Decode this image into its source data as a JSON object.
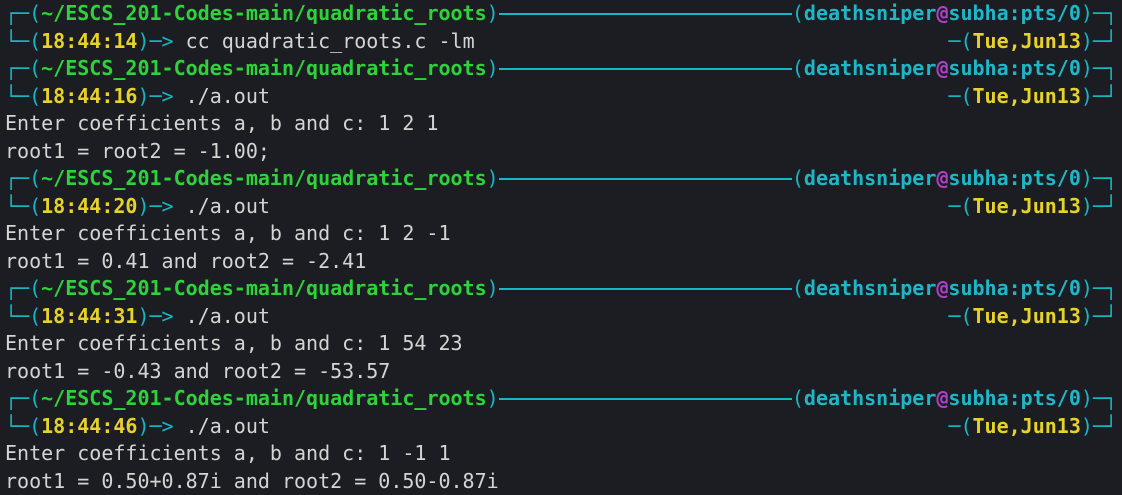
{
  "blocks": [
    {
      "path": "~/ESCS_201-Codes-main/quadratic_roots",
      "user": "deathsniper",
      "host": "subha:pts/0",
      "time": "18:44:14",
      "date": "Tue,Jun13",
      "command": "cc quadratic_roots.c -lm",
      "output": []
    },
    {
      "path": "~/ESCS_201-Codes-main/quadratic_roots",
      "user": "deathsniper",
      "host": "subha:pts/0",
      "time": "18:44:16",
      "date": "Tue,Jun13",
      "command": "./a.out",
      "output": [
        "Enter coefficients a, b and c: 1 2 1",
        "root1 = root2 = -1.00;"
      ]
    },
    {
      "path": "~/ESCS_201-Codes-main/quadratic_roots",
      "user": "deathsniper",
      "host": "subha:pts/0",
      "time": "18:44:20",
      "date": "Tue,Jun13",
      "command": "./a.out",
      "output": [
        "Enter coefficients a, b and c: 1 2 -1",
        "root1 = 0.41 and root2 = -2.41"
      ]
    },
    {
      "path": "~/ESCS_201-Codes-main/quadratic_roots",
      "user": "deathsniper",
      "host": "subha:pts/0",
      "time": "18:44:31",
      "date": "Tue,Jun13",
      "command": "./a.out",
      "output": [
        "Enter coefficients a, b and c: 1 54 23",
        "root1 = -0.43 and root2 = -53.57"
      ]
    },
    {
      "path": "~/ESCS_201-Codes-main/quadratic_roots",
      "user": "deathsniper",
      "host": "subha:pts/0",
      "time": "18:44:46",
      "date": "Tue,Jun13",
      "command": "./a.out",
      "output": [
        "Enter coefficients a, b and c: 1 -1 1",
        "root1 = 0.50+0.87i and root2 = 0.50-0.87i"
      ]
    }
  ],
  "glyphs": {
    "top_left": "┌─(",
    "bottom_left": "└─(",
    "close_paren": ")",
    "open_paren": "(",
    "arrow": "─> ",
    "at": "@",
    "top_right": ")─┐",
    "bottom_right_lead": "─(",
    "bottom_right": ")─┘"
  },
  "colors": {
    "background": "#1c1d22",
    "frame": "#16b7c4",
    "path": "#2ed23a",
    "time": "#e6d22a",
    "user": "#1fb7c8",
    "at": "#b042c8",
    "text": "#d4d4d4"
  }
}
